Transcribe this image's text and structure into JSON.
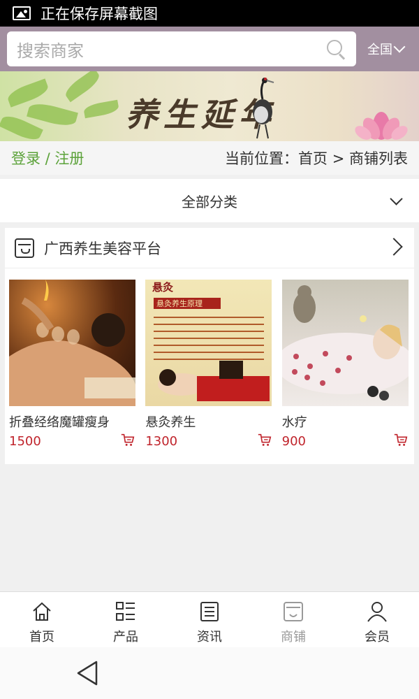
{
  "status_bar": {
    "text": "正在保存屏幕截图",
    "icon": "image-icon"
  },
  "search": {
    "placeholder": "搜索商家",
    "region": "全国"
  },
  "banner": {
    "title": "养生延年"
  },
  "nav": {
    "login": "登录 / 注册",
    "location": "当前位置：首页 > 商铺列表"
  },
  "category": {
    "label": "全部分类"
  },
  "store": {
    "name": "广西养生美容平台",
    "products": [
      {
        "name": "折叠经络魔罐瘦身",
        "price": "1500"
      },
      {
        "name": "悬灸养生",
        "price": "1300",
        "img_heading": "悬灸",
        "img_subheading": "悬灸养生原理"
      },
      {
        "name": "水疗",
        "price": "900"
      }
    ]
  },
  "tabs": [
    {
      "label": "首页",
      "icon": "home-icon",
      "active": false
    },
    {
      "label": "产品",
      "icon": "list-icon",
      "active": false
    },
    {
      "label": "资讯",
      "icon": "news-icon",
      "active": false
    },
    {
      "label": "商铺",
      "icon": "store-icon",
      "active": true
    },
    {
      "label": "会员",
      "icon": "user-icon",
      "active": false
    }
  ],
  "colors": {
    "header": "#a28fa0",
    "login": "#5ca23a",
    "price": "#c0242c",
    "inactive_tab": "#999999"
  }
}
